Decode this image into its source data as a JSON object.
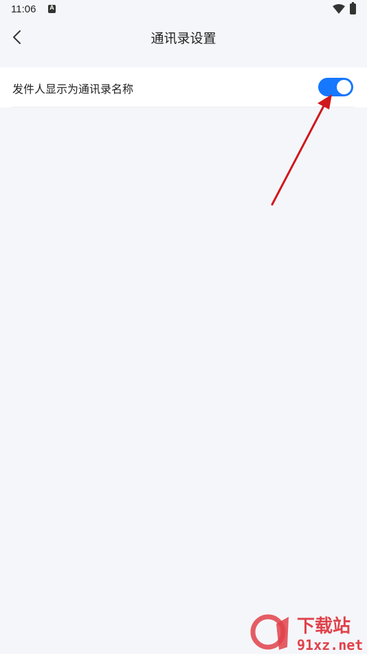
{
  "status_bar": {
    "time": "11:06",
    "notification_icon": "a-icon"
  },
  "header": {
    "title": "通讯录设置",
    "back_icon": "chevron-left-icon"
  },
  "settings": {
    "items": [
      {
        "label": "发件人显示为通讯录名称",
        "enabled": true
      }
    ]
  },
  "colors": {
    "accent": "#1677ff",
    "background": "#f5f6fa",
    "annotation_arrow": "#d0181c"
  },
  "watermark": {
    "logo": "9f",
    "brand": "下载站",
    "domain": "91xz.net"
  }
}
